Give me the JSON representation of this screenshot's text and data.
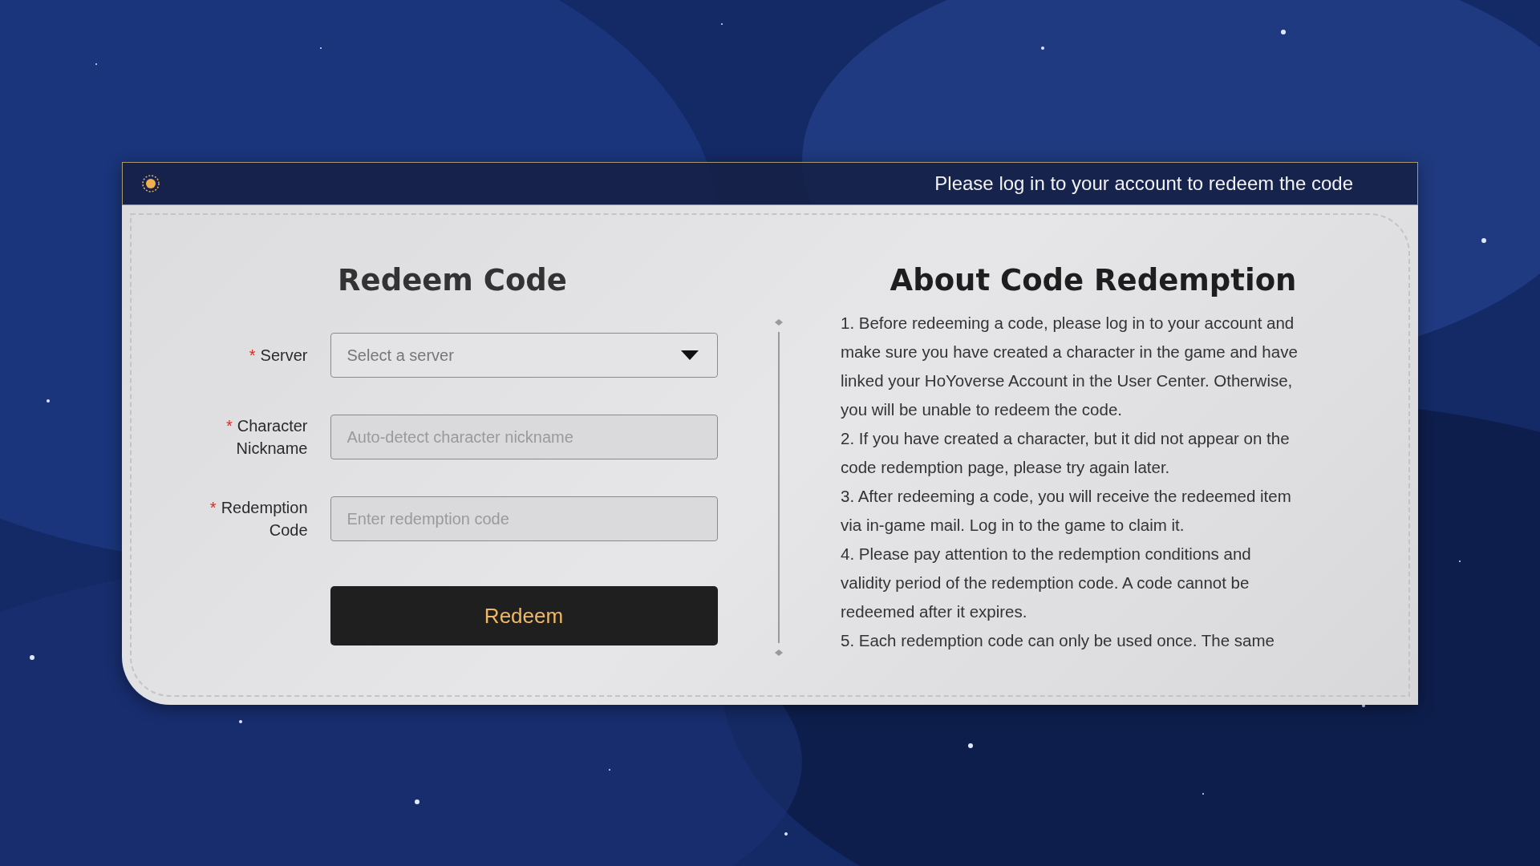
{
  "header": {
    "message": "Please log in to your account to redeem the code"
  },
  "form": {
    "title": "Redeem Code",
    "fields": [
      {
        "kind": "select",
        "required_mark": "*",
        "label": "Server",
        "placeholder": "Select a server"
      },
      {
        "kind": "text",
        "required_mark": "*",
        "label": "Character Nickname",
        "placeholder": "Auto-detect character nickname"
      },
      {
        "kind": "text",
        "required_mark": "*",
        "label": "Redemption Code",
        "placeholder": "Enter redemption code"
      }
    ],
    "button": "Redeem"
  },
  "about": {
    "title": "About Code Redemption",
    "items": [
      "1. Before redeeming a code, please log in to your account and make sure you have created a character in the game and have linked your HoYoverse Account in the User Center. Otherwise, you will be unable to redeem the code.",
      "2. If you have created a character, but it did not appear on the code redemption page, please try again later.",
      "3. After redeeming a code, you will receive the redeemed item via in-game mail. Log in to the game to claim it.",
      "4. Please pay attention to the redemption conditions and validity period of the redemption code. A code cannot be redeemed after it expires.",
      "5. Each redemption code can only be used once. The same"
    ]
  }
}
